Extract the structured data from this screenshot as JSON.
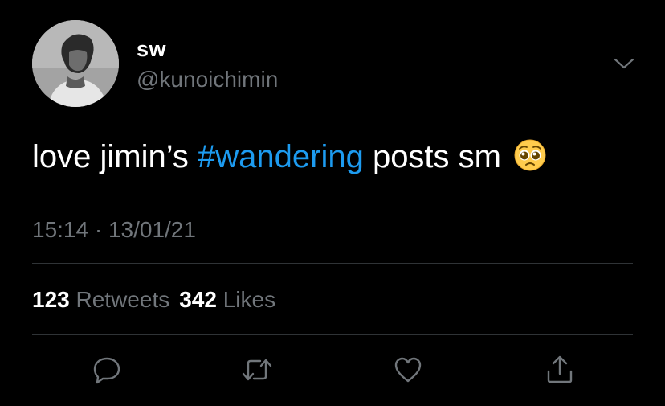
{
  "tweet": {
    "author": {
      "display_name": "sw",
      "handle": "@kunoichimin",
      "avatar_icon": "profile-photo"
    },
    "text": {
      "before": "love jimin’s ",
      "hashtag": "#wandering",
      "after": " posts sm",
      "emoji": "pleading-face-emoji"
    },
    "timestamp": "15:14 · 13/01/21",
    "stats": {
      "retweets_count": "123",
      "retweets_label": "Retweets",
      "likes_count": "342",
      "likes_label": "Likes"
    },
    "actions": [
      {
        "name": "reply",
        "icon": "reply-icon"
      },
      {
        "name": "retweet",
        "icon": "retweet-icon"
      },
      {
        "name": "like",
        "icon": "heart-icon"
      },
      {
        "name": "share",
        "icon": "share-icon"
      }
    ],
    "more_menu_icon": "chevron-down-icon"
  },
  "colors": {
    "background": "#000000",
    "primary_text": "#ffffff",
    "secondary_text": "#71767b",
    "hashtag": "#1d9bf0",
    "divider": "#2f3336"
  }
}
